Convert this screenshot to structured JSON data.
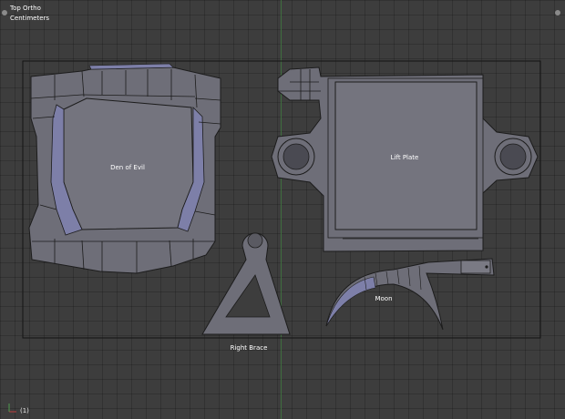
{
  "viewport": {
    "view_name": "Top Ortho",
    "units": "Centimeters",
    "frame_indicator": "(1)"
  },
  "objects": {
    "den_of_evil": "Den of Evil",
    "lift_plate": "Lift Plate",
    "moon": "Moon",
    "right_brace": "Right Brace"
  },
  "colors": {
    "background": "#3d3d3d",
    "mesh_fill": "#6e6e78",
    "mesh_edge": "#1c1c1c",
    "selection_highlight": "#7d7fa8",
    "camera_border": "#141414",
    "y_axis": "#3f6e3f"
  }
}
